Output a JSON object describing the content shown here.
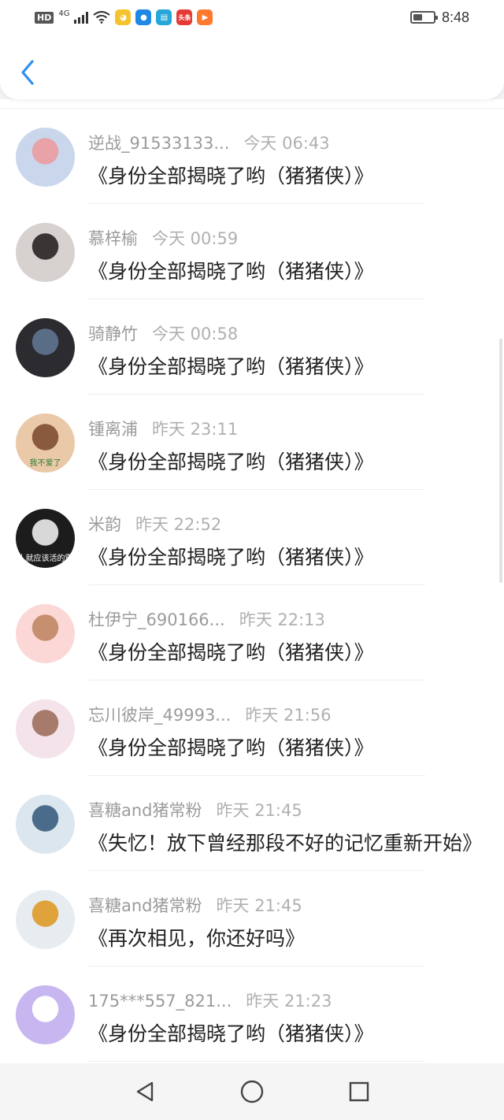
{
  "status_bar": {
    "hd": "HD",
    "network": "4G",
    "time": "8:48",
    "battery_level": 0.45,
    "app_icons": [
      {
        "name": "duckling-app-icon",
        "color": "#f4c430",
        "glyph": "◕"
      },
      {
        "name": "browser-app-icon",
        "color": "#1e88e5",
        "glyph": "●"
      },
      {
        "name": "reader-app-icon",
        "color": "#26a6d9",
        "glyph": "▤"
      },
      {
        "name": "toutiao-app-icon",
        "color": "#e53935",
        "glyph": "头条"
      },
      {
        "name": "video-app-icon",
        "color": "#ff7a2f",
        "glyph": "▶"
      }
    ]
  },
  "header": {
    "back_icon": "chevron-left-icon",
    "accent_color": "#2f8ef0"
  },
  "conversations": [
    {
      "name": "逆战_91533133...",
      "time": "今天 06:43",
      "message": "《身份全部揭晓了哟（猪猪侠）》",
      "avatar_bg": "#c9d6ec",
      "avatar_fg": "#e8a2a8"
    },
    {
      "name": "慕梓榆",
      "time": "今天 00:59",
      "message": "《身份全部揭晓了哟（猪猪侠）》",
      "avatar_bg": "#d7d2cf",
      "avatar_fg": "#3a3534"
    },
    {
      "name": "骑静竹",
      "time": "今天 00:58",
      "message": "《身份全部揭晓了哟（猪猪侠）》",
      "avatar_bg": "#2b2b30",
      "avatar_fg": "#5a6d86"
    },
    {
      "name": "锺离浦",
      "time": "昨天 23:11",
      "message": "《身份全部揭晓了哟（猪猪侠）》",
      "avatar_bg": "#e9c9a8",
      "avatar_fg": "#8a5a3c",
      "avatar_caption": "我不爱了"
    },
    {
      "name": "米韵",
      "time": "昨天 22:52",
      "message": "《身份全部揭晓了哟（猪猪侠）》",
      "avatar_bg": "#1c1c1c",
      "avatar_fg": "#d8d8d8",
      "avatar_caption": "人就应该活的霸"
    },
    {
      "name": "杜伊宁_690166...",
      "time": "昨天 22:13",
      "message": "《身份全部揭晓了哟（猪猪侠）》",
      "avatar_bg": "#fbd8d6",
      "avatar_fg": "#c69070"
    },
    {
      "name": "忘川彼岸_49993...",
      "time": "昨天 21:56",
      "message": "《身份全部揭晓了哟（猪猪侠）》",
      "avatar_bg": "#f4e3ea",
      "avatar_fg": "#a67b6b"
    },
    {
      "name": "喜糖and猪常粉",
      "time": "昨天 21:45",
      "message": "《失忆！放下曾经那段不好的记忆重新开始》",
      "avatar_bg": "#dbe6ee",
      "avatar_fg": "#4a6b8a"
    },
    {
      "name": "喜糖and猪常粉",
      "time": "昨天 21:45",
      "message": "《再次相见，你还好吗》",
      "avatar_bg": "#e6ecf0",
      "avatar_fg": "#e0a23a"
    },
    {
      "name": "175***557_821...",
      "time": "昨天 21:23",
      "message": "《身份全部揭晓了哟（猪猪侠）》",
      "avatar_bg": "#c8b6f0",
      "avatar_fg": "#ffffff"
    }
  ],
  "nav_bar": {
    "back": "triangle-back-icon",
    "home": "circle-home-icon",
    "recents": "square-recents-icon"
  }
}
